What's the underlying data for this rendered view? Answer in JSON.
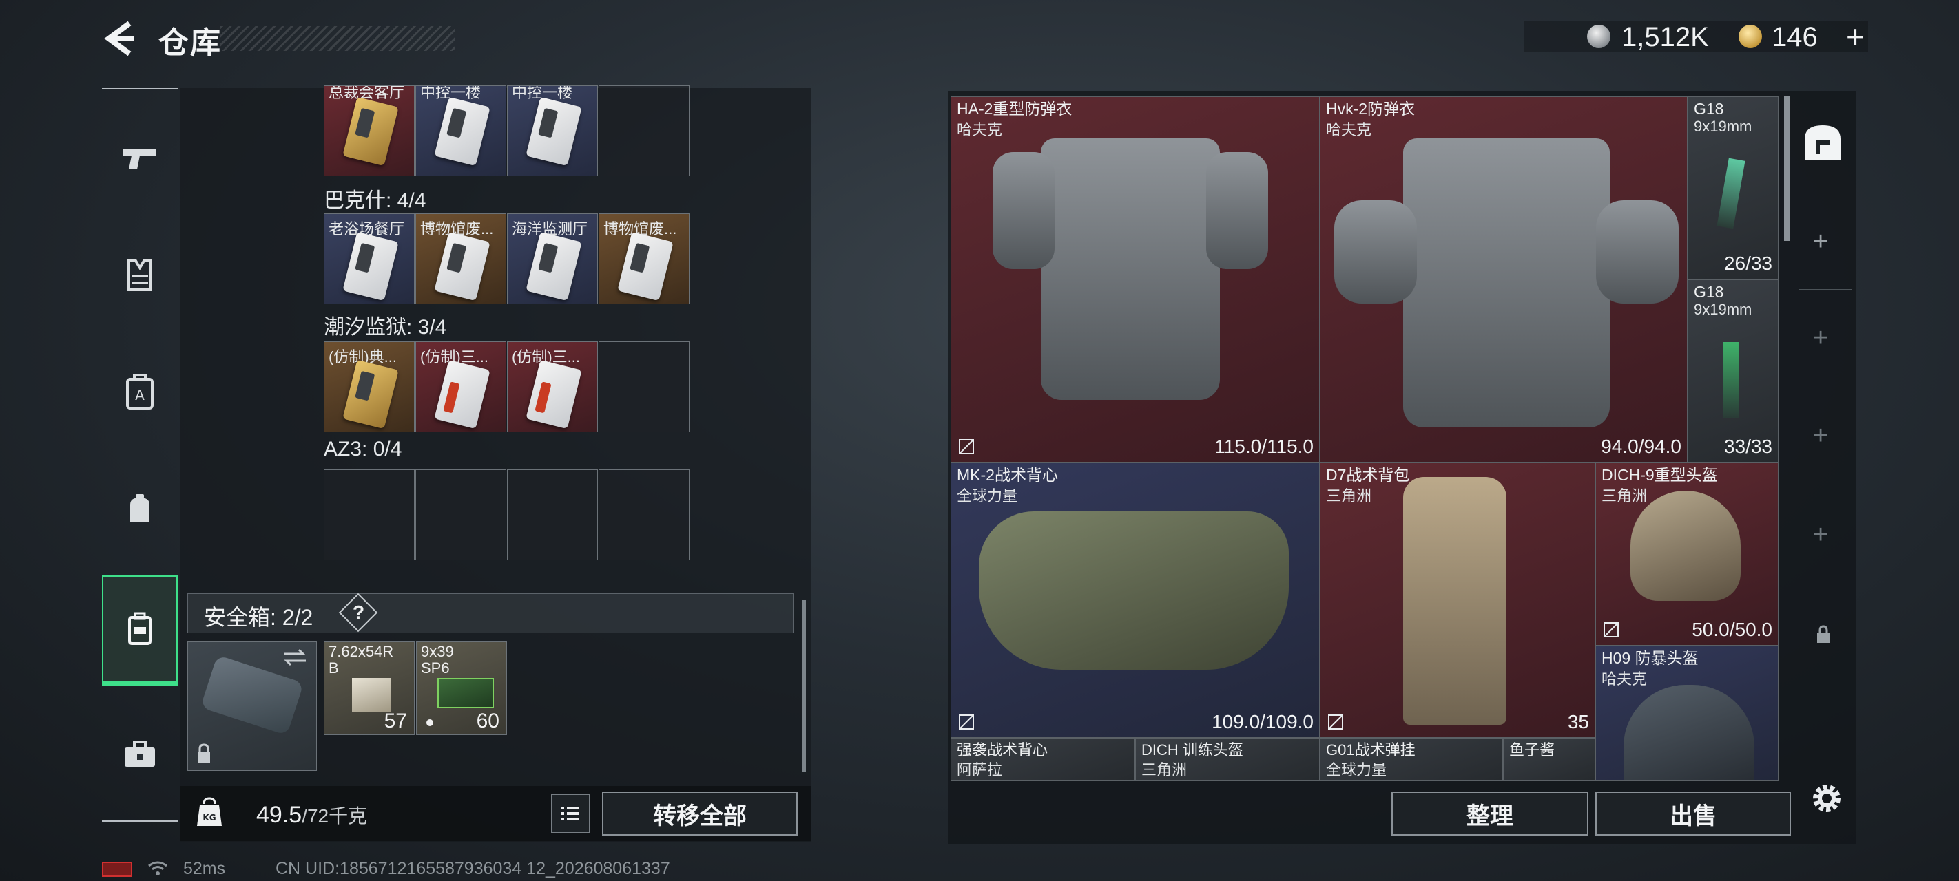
{
  "header": {
    "back_icon": "back-arrow-icon",
    "title": "仓库",
    "silver_amount": "1,512K",
    "gold_amount": "146",
    "plus_label": "+"
  },
  "left_nav": {
    "items": [
      {
        "icon": "pistol-icon"
      },
      {
        "icon": "armor-vest-icon"
      },
      {
        "icon": "chest-rig-icon"
      },
      {
        "icon": "backpack-icon"
      },
      {
        "icon": "safe-box-icon",
        "active": true
      },
      {
        "icon": "toolbox-icon"
      }
    ]
  },
  "keycards": {
    "row0": [
      {
        "label": "总裁会客厅",
        "color": "red"
      },
      {
        "label": "中控一楼",
        "color": "blue"
      },
      {
        "label": "中控一楼",
        "color": "blue"
      },
      {
        "label": "",
        "color": "empty"
      }
    ],
    "group1": {
      "title": "巴克什: 4/4",
      "cells": [
        {
          "label": "老浴场餐厅",
          "color": "blue"
        },
        {
          "label": "博物馆废...",
          "color": "orange"
        },
        {
          "label": "海洋监测厅",
          "color": "blue"
        },
        {
          "label": "博物馆废...",
          "color": "orange"
        }
      ]
    },
    "group2": {
      "title": "潮汐监狱: 3/4",
      "cells": [
        {
          "label": "(仿制)典...",
          "color": "orange"
        },
        {
          "label": "(仿制)三...",
          "color": "red"
        },
        {
          "label": "(仿制)三...",
          "color": "red"
        },
        {
          "label": "",
          "color": "empty"
        }
      ]
    },
    "group3": {
      "title": "AZ3: 0/4"
    }
  },
  "safe_box": {
    "title": "安全箱: 2/2",
    "help_label": "?",
    "ammo": [
      {
        "name_line1": "7.62x54R",
        "name_line2": "B",
        "count": "57"
      },
      {
        "name_line1": "9x39",
        "name_line2": "SP6",
        "count": "60"
      }
    ]
  },
  "bottom_bar": {
    "weight_value": "49.5",
    "weight_unit": "/72千克",
    "transfer_all": "转移全部"
  },
  "inventory": {
    "items": [
      {
        "name": "HA-2重型防弹衣",
        "maker": "哈夫克",
        "durability": "115.0/115.0"
      },
      {
        "name": "Hvk-2防弹衣",
        "maker": "哈夫克",
        "durability": "94.0/94.0"
      },
      {
        "name": "G18",
        "maker": "9x19mm",
        "durability": "26/33"
      },
      {
        "name": "G18",
        "maker": "9x19mm",
        "durability": "33/33"
      },
      {
        "name": "MK-2战术背心",
        "maker": "全球力量",
        "durability": "109.0/109.0"
      },
      {
        "name": "D7战术背包",
        "maker": "三角洲",
        "durability": "35"
      },
      {
        "name": "DICH-9重型头盔",
        "maker": "三角洲",
        "durability": "50.0/50.0"
      },
      {
        "name": "H09 防暴头盔",
        "maker": "哈夫克"
      },
      {
        "name": "强袭战术背心",
        "maker": "阿萨拉"
      },
      {
        "name": "DICH 训练头盔",
        "maker": "三角洲"
      },
      {
        "name": "G01战术弹挂",
        "maker": "全球力量"
      },
      {
        "name": "鱼子酱",
        "maker": ""
      }
    ]
  },
  "actions": {
    "sort": "整理",
    "sell": "出售"
  },
  "footer": {
    "ping": "52ms",
    "uid": "CN UID:1856712165587936034 12_202608061337"
  },
  "colors": {
    "accent_green": "#3ee08a",
    "rarity_red": "#5f2a31",
    "rarity_blue": "#33395a",
    "rarity_orange": "#6e5030"
  }
}
